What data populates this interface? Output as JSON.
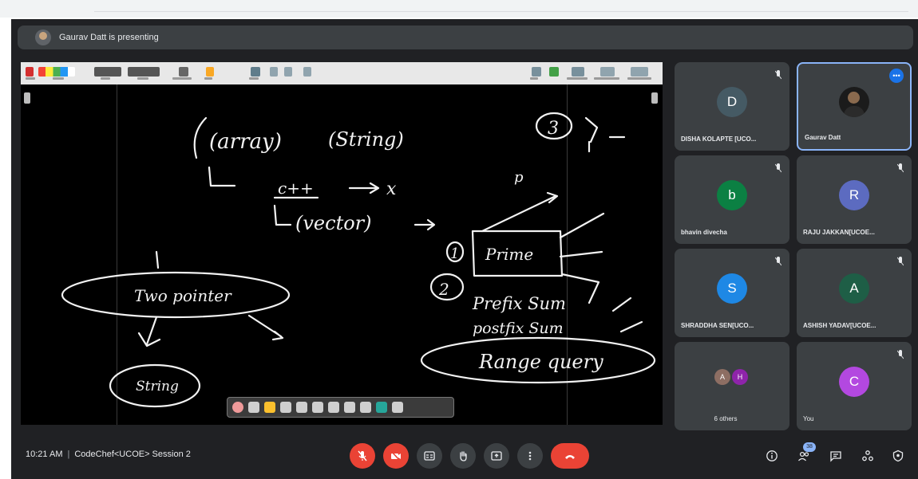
{
  "presentation": {
    "banner_text": "Gaurav Datt is presenting"
  },
  "whiteboard": {
    "ink_texts": [
      "(array)",
      "(String)",
      "c++",
      "(vector)",
      "Prime",
      "Two pointer",
      "Prefix Sum",
      "postfix Sum",
      "Range query",
      "String"
    ],
    "ink_numbers": [
      "1",
      "2",
      "3"
    ],
    "ink_letters": [
      "x",
      "p"
    ]
  },
  "participants": [
    {
      "name": "DISHA KOLAPTE [UCO...",
      "initial": "D",
      "avatar_color": "#455a64",
      "muted": true
    },
    {
      "name": "Gaurav Datt",
      "initial": "",
      "avatar_color": "#1b1b1b",
      "active": true
    },
    {
      "name": "bhavin divecha",
      "initial": "b",
      "avatar_color": "#0b8043",
      "muted": true
    },
    {
      "name": "RAJU JAKKAN[UCOE...",
      "initial": "R",
      "avatar_color": "#5c6bc0",
      "muted": true
    },
    {
      "name": "SHRADDHA SEN[UCO...",
      "initial": "S",
      "avatar_color": "#1e88e5",
      "muted": true
    },
    {
      "name": "ASHISH YADAV[UCOE...",
      "initial": "A",
      "avatar_color": "#1e5e46",
      "muted": true
    },
    {
      "name": "6 others",
      "mini_initials": [
        "A",
        "H"
      ],
      "mini_colors": [
        "#8d6e63",
        "#8e24aa"
      ]
    },
    {
      "name": "You",
      "initial": "C",
      "avatar_color": "#b348e0",
      "muted": true
    }
  ],
  "meeting": {
    "time": "10:21 AM",
    "separator": "|",
    "title": "CodeChef<UCOE> Session 2"
  },
  "controls": {
    "people_count": "38",
    "icons": [
      "mic-off-icon",
      "camera-off-icon",
      "captions-icon",
      "raise-hand-icon",
      "present-icon",
      "more-options-icon",
      "end-call-icon",
      "info-icon",
      "people-icon",
      "chat-icon",
      "activities-icon",
      "host-controls-icon"
    ]
  },
  "colors": {
    "background": "#202124",
    "tile": "#3c4043",
    "accent": "#8ab4f8",
    "danger": "#ea4335"
  }
}
